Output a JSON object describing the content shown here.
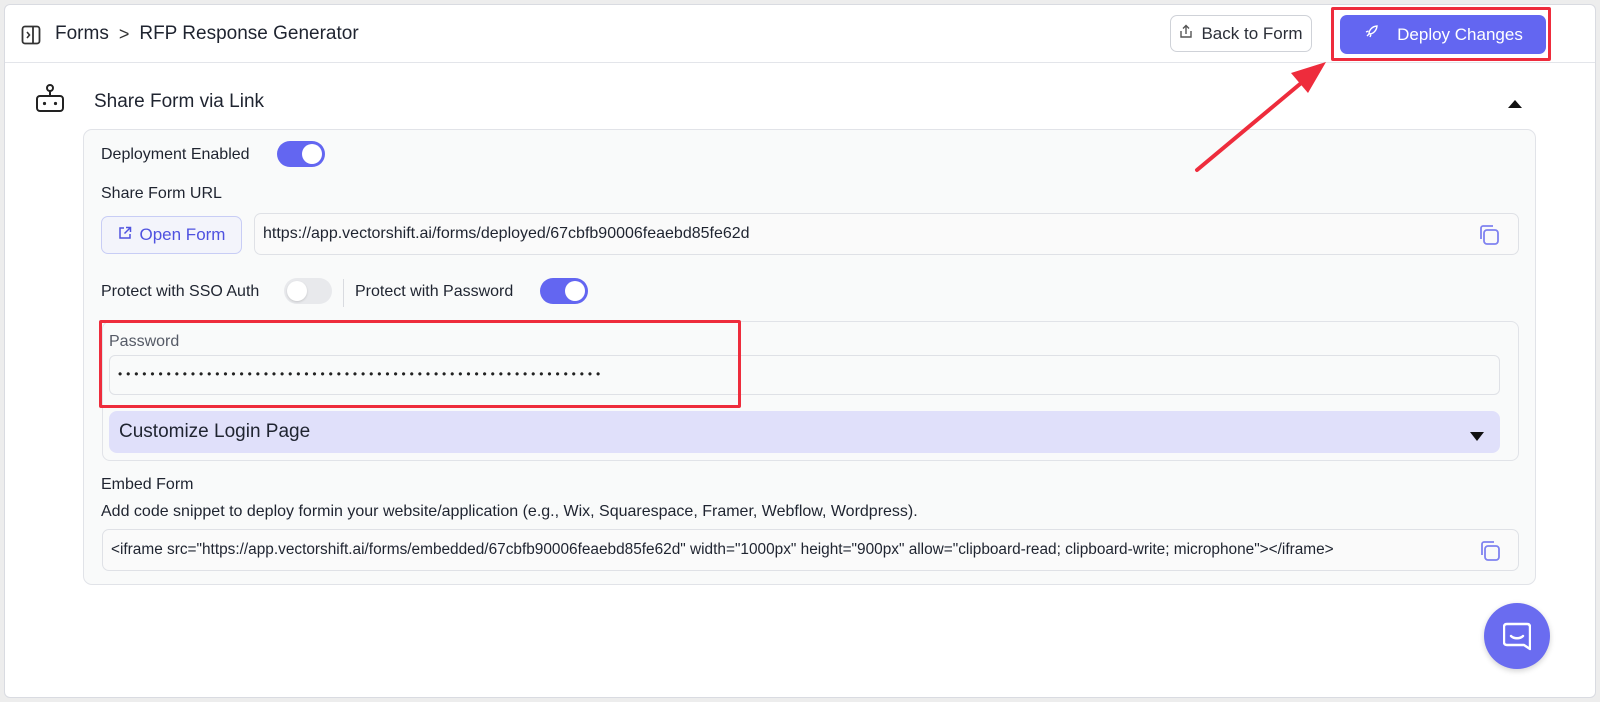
{
  "header": {
    "breadcrumb": {
      "root": "Forms",
      "separator": ">",
      "current": "RFP Response Generator"
    },
    "back_button": "Back to Form",
    "deploy_button": "Deploy Changes"
  },
  "section": {
    "title": "Share Form via Link"
  },
  "deployment": {
    "label": "Deployment Enabled",
    "enabled": true
  },
  "share_url": {
    "label": "Share Form URL",
    "open_button": "Open Form",
    "value": "https://app.vectorshift.ai/forms/deployed/67cbfb90006feaebd85fe62d"
  },
  "protection": {
    "sso_label": "Protect with SSO Auth",
    "sso_enabled": false,
    "password_label": "Protect with Password",
    "password_enabled": true
  },
  "password": {
    "label": "Password",
    "masked_value": "••••••••••••••••••••••••••••••••••••••••••••••••••••••••••••"
  },
  "customize_login": {
    "label": "Customize Login Page"
  },
  "embed": {
    "title": "Embed Form",
    "description": "Add code snippet to deploy formin your website/application (e.g., Wix, Squarespace, Framer, Webflow, Wordpress).",
    "snippet": "<iframe src=\"https://app.vectorshift.ai/forms/embedded/67cbfb90006feaebd85fe62d\" width=\"1000px\" height=\"900px\" allow=\"clipboard-read; clipboard-write; microphone\"></iframe>"
  },
  "colors": {
    "accent": "#6366f1",
    "highlight": "#ee2c3c",
    "customize_bg": "#e0e0fa"
  },
  "icons": [
    "sidebar-toggle-icon",
    "upload-icon",
    "rocket-icon",
    "robot-icon",
    "caret-up-icon",
    "external-link-icon",
    "copy-icon",
    "caret-down-icon",
    "chat-icon"
  ]
}
